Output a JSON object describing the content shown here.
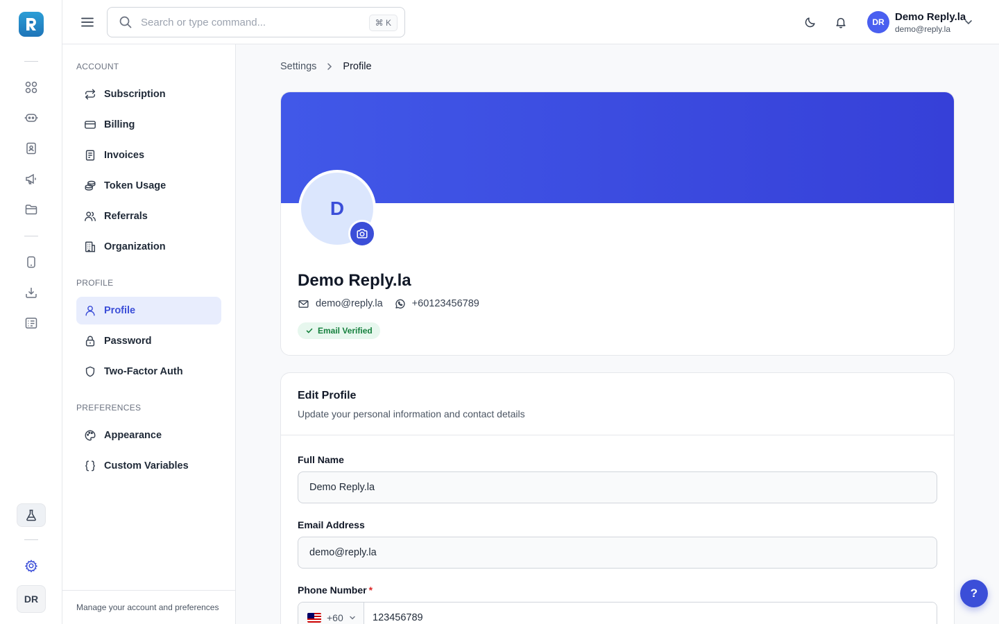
{
  "app": {
    "logo_letter": "R",
    "brand_color": "#3b4ed8"
  },
  "rail": {
    "icons": [
      "apps-grid-icon",
      "chatbot-icon",
      "contacts-icon",
      "megaphone-icon",
      "folder-icon",
      "device-icon",
      "download-icon",
      "list-check-icon",
      "flask-icon",
      "gear-icon"
    ],
    "avatar_initials": "DR"
  },
  "search": {
    "placeholder": "Search or type command...",
    "shortcut": "⌘ K"
  },
  "user": {
    "initials": "DR",
    "name": "Demo Reply.la",
    "email": "demo@reply.la"
  },
  "settings_nav": {
    "sections": [
      {
        "title": "ACCOUNT",
        "items": [
          {
            "label": "Subscription",
            "icon": "repeat-icon"
          },
          {
            "label": "Billing",
            "icon": "credit-card-icon"
          },
          {
            "label": "Invoices",
            "icon": "invoice-icon"
          },
          {
            "label": "Token Usage",
            "icon": "coins-icon"
          },
          {
            "label": "Referrals",
            "icon": "users-icon"
          },
          {
            "label": "Organization",
            "icon": "building-icon"
          }
        ]
      },
      {
        "title": "PROFILE",
        "items": [
          {
            "label": "Profile",
            "icon": "user-icon",
            "active": true
          },
          {
            "label": "Password",
            "icon": "lock-icon"
          },
          {
            "label": "Two-Factor Auth",
            "icon": "shield-icon"
          }
        ]
      },
      {
        "title": "PREFERENCES",
        "items": [
          {
            "label": "Appearance",
            "icon": "palette-icon"
          },
          {
            "label": "Custom Variables",
            "icon": "braces-icon"
          }
        ]
      }
    ],
    "footer": "Manage your account and preferences"
  },
  "breadcrumb": {
    "parent": "Settings",
    "current": "Profile"
  },
  "profile": {
    "avatar_letter": "D",
    "name": "Demo Reply.la",
    "email": "demo@reply.la",
    "phone": "+60123456789",
    "badge": "Email Verified"
  },
  "edit_profile": {
    "title": "Edit Profile",
    "subtitle": "Update your personal information and contact details",
    "full_name": {
      "label": "Full Name",
      "value": "Demo Reply.la"
    },
    "email": {
      "label": "Email Address",
      "value": "demo@reply.la"
    },
    "phone": {
      "label": "Phone Number",
      "required_mark": "*",
      "country_code": "+60",
      "value": "123456789"
    }
  },
  "help": {
    "label": "?"
  }
}
